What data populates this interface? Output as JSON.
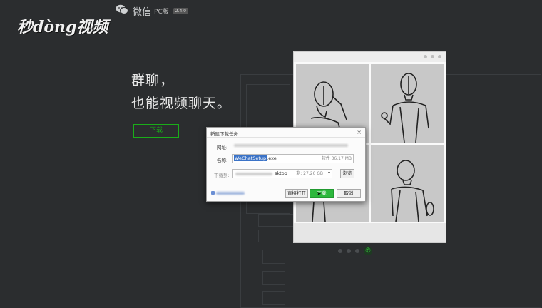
{
  "watermark": {
    "logo_text": "秒dòng视频"
  },
  "brand": {
    "name": "微信",
    "pc": "PC版",
    "version": "2.4.0"
  },
  "hero": {
    "line1": "群聊，",
    "line2": "也能视频聊天。",
    "download_label": "下载"
  },
  "dialog": {
    "title": "新建下载任务",
    "close": "×",
    "url_label": "网址:",
    "name_label": "名称:",
    "file_name_selected": "WeChatSetup",
    "file_name_ext": ".exe",
    "file_info": "软件 36.17 MB",
    "path_label": "下载到:",
    "path_value": "sktop",
    "free_space": "剩: 27.26 GB",
    "browse_button": "浏览",
    "open_button": "直接打开",
    "download_button": "下载",
    "cancel_button": "取消"
  },
  "colors": {
    "accent": "#1aad19",
    "background": "#2b2d2f",
    "selection": "#3b73c7"
  },
  "icons": {
    "brand": "wechat-icon",
    "call": "phone-icon"
  }
}
